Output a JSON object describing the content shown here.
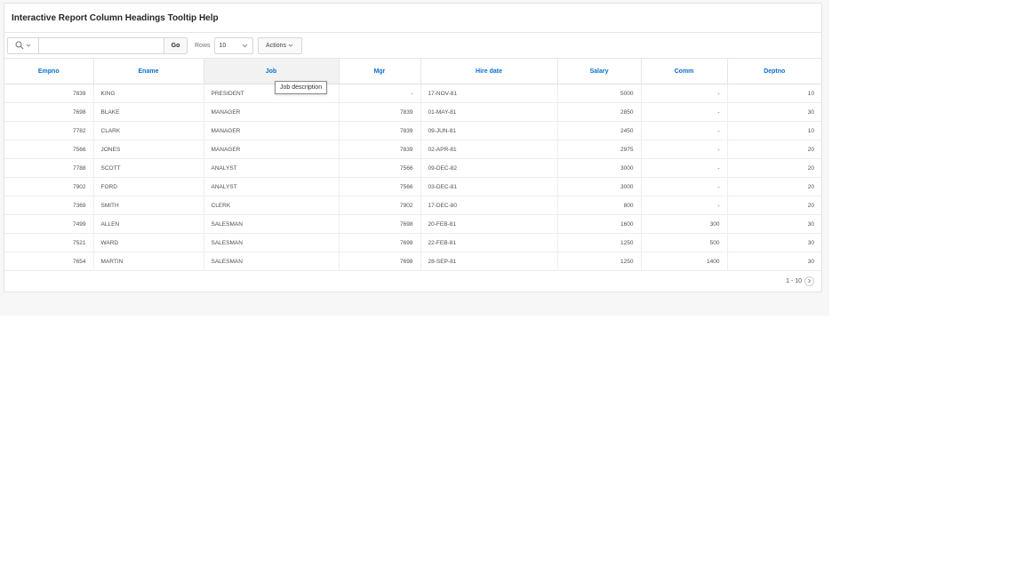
{
  "region": {
    "title": "Interactive Report Column Headings Tooltip Help"
  },
  "toolbar": {
    "search_icon": "search-icon",
    "search_value": "",
    "go_label": "Go",
    "rows_label": "Rows",
    "rows_value": "10",
    "actions_label": "Actions"
  },
  "columns": [
    "Empno",
    "Ename",
    "Job",
    "Mgr",
    "Hire date",
    "Salary",
    "Comm",
    "Deptno"
  ],
  "rows": [
    {
      "empno": "7839",
      "ename": "KING",
      "job": "PRESIDENT",
      "mgr": "-",
      "hiredate": "17-NOV-81",
      "sal": "5000",
      "comm": "-",
      "deptno": "10"
    },
    {
      "empno": "7698",
      "ename": "BLAKE",
      "job": "MANAGER",
      "mgr": "7839",
      "hiredate": "01-MAY-81",
      "sal": "2850",
      "comm": "-",
      "deptno": "30"
    },
    {
      "empno": "7782",
      "ename": "CLARK",
      "job": "MANAGER",
      "mgr": "7839",
      "hiredate": "09-JUN-81",
      "sal": "2450",
      "comm": "-",
      "deptno": "10"
    },
    {
      "empno": "7566",
      "ename": "JONES",
      "job": "MANAGER",
      "mgr": "7839",
      "hiredate": "02-APR-81",
      "sal": "2975",
      "comm": "-",
      "deptno": "20"
    },
    {
      "empno": "7788",
      "ename": "SCOTT",
      "job": "ANALYST",
      "mgr": "7566",
      "hiredate": "09-DEC-82",
      "sal": "3000",
      "comm": "-",
      "deptno": "20"
    },
    {
      "empno": "7902",
      "ename": "FORD",
      "job": "ANALYST",
      "mgr": "7566",
      "hiredate": "03-DEC-81",
      "sal": "3000",
      "comm": "-",
      "deptno": "20"
    },
    {
      "empno": "7369",
      "ename": "SMITH",
      "job": "CLERK",
      "mgr": "7902",
      "hiredate": "17-DEC-80",
      "sal": "800",
      "comm": "-",
      "deptno": "20"
    },
    {
      "empno": "7499",
      "ename": "ALLEN",
      "job": "SALESMAN",
      "mgr": "7698",
      "hiredate": "20-FEB-81",
      "sal": "1600",
      "comm": "300",
      "deptno": "30"
    },
    {
      "empno": "7521",
      "ename": "WARD",
      "job": "SALESMAN",
      "mgr": "7698",
      "hiredate": "22-FEB-81",
      "sal": "1250",
      "comm": "500",
      "deptno": "30"
    },
    {
      "empno": "7654",
      "ename": "MARTIN",
      "job": "SALESMAN",
      "mgr": "7698",
      "hiredate": "28-SEP-81",
      "sal": "1250",
      "comm": "1400",
      "deptno": "30"
    }
  ],
  "pagination": {
    "range": "1 - 10"
  },
  "tooltip": {
    "text": "Job description"
  },
  "colors": {
    "header_link": "#0b6fd1",
    "page_background": "#f7f7f7"
  }
}
